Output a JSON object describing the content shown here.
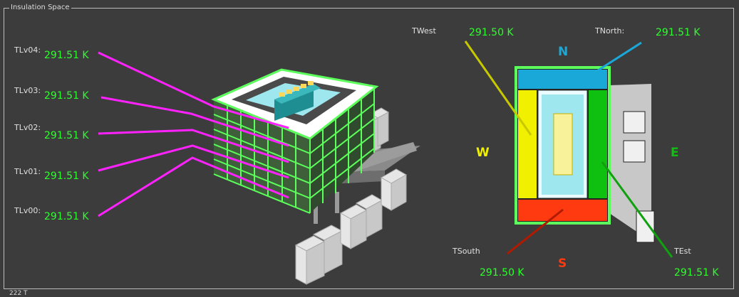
{
  "panel": {
    "title": "Insulation Space"
  },
  "levels": [
    {
      "label": "TLv04:",
      "value": "291.51 K"
    },
    {
      "label": "TLv03:",
      "value": "291.51 K"
    },
    {
      "label": "TLv02:",
      "value": "291.51 K"
    },
    {
      "label": "TLv01:",
      "value": "291.51 K"
    },
    {
      "label": "TLv00:",
      "value": "291.51 K"
    }
  ],
  "facades": {
    "west": {
      "label": "TWest",
      "value": "291.50 K"
    },
    "north": {
      "label": "TNorth:",
      "value": "291.51 K"
    },
    "south": {
      "label": "TSouth",
      "value": "291.50 K"
    },
    "east": {
      "label": "TEst",
      "value": "291.51 K"
    }
  },
  "compass": {
    "n": "N",
    "s": "S",
    "e": "E",
    "w": "W"
  },
  "colors": {
    "level_line": "#ff22ff",
    "value_text": "#2cff2c",
    "north": "#1aa8d8",
    "south": "#ff3a10",
    "west": "#f0f000",
    "east": "#10c010",
    "west_line": "#c8c800",
    "south_line": "#b01a00",
    "east_line": "#10a010",
    "north_line": "#1aa8d8"
  },
  "footer_fragment": "222 T"
}
